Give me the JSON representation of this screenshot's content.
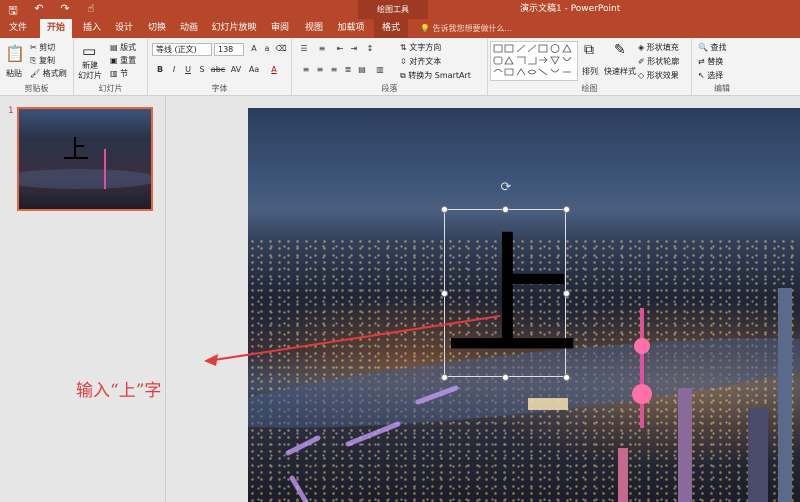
{
  "titlebar": {
    "doc_title": "演示文稿1 - PowerPoint",
    "tools_label": "绘图工具",
    "qat": {
      "save": "🖫",
      "undo": "↶",
      "redo": "↷",
      "touch": "☝"
    }
  },
  "tabs": [
    {
      "label": "文件"
    },
    {
      "label": "开始"
    },
    {
      "label": "插入"
    },
    {
      "label": "设计"
    },
    {
      "label": "切换"
    },
    {
      "label": "动画"
    },
    {
      "label": "幻灯片放映"
    },
    {
      "label": "审阅"
    },
    {
      "label": "视图"
    },
    {
      "label": "加载项"
    },
    {
      "label": "格式"
    }
  ],
  "tell_me": "告诉我您想要做什么...",
  "ribbon": {
    "clipboard": {
      "label": "剪贴板",
      "paste": "粘贴",
      "cut": "剪切",
      "copy": "复制",
      "format_painter": "格式刷"
    },
    "slides": {
      "label": "幻灯片",
      "new_slide": "新建",
      "new_slide2": "幻灯片",
      "layout": "版式",
      "reset": "重置",
      "section": "节"
    },
    "font": {
      "label": "字体",
      "font_name": "等线 (正文)",
      "font_size": "138",
      "bold": "B",
      "italic": "I",
      "underline": "U",
      "strike": "S",
      "shadow": "abc",
      "spacing": "AV",
      "case": "Aa",
      "color": "A"
    },
    "paragraph": {
      "label": "段落",
      "text_direction": "文字方向",
      "align_text": "对齐文本",
      "smartart": "转换为 SmartArt"
    },
    "drawing": {
      "label": "绘图",
      "arrange": "排列",
      "quick_styles": "快速样式",
      "shape_fill": "形状填充",
      "shape_outline": "形状轮廓",
      "shape_effects": "形状效果"
    },
    "editing": {
      "label": "编辑",
      "find": "查找",
      "replace": "替换",
      "select": "选择"
    }
  },
  "thumbnails": {
    "slide_number": "1"
  },
  "slide": {
    "text": "上"
  },
  "annotation": "输入“上”字",
  "colors": {
    "accent": "#b7472a",
    "arrow": "#e23b3b"
  }
}
